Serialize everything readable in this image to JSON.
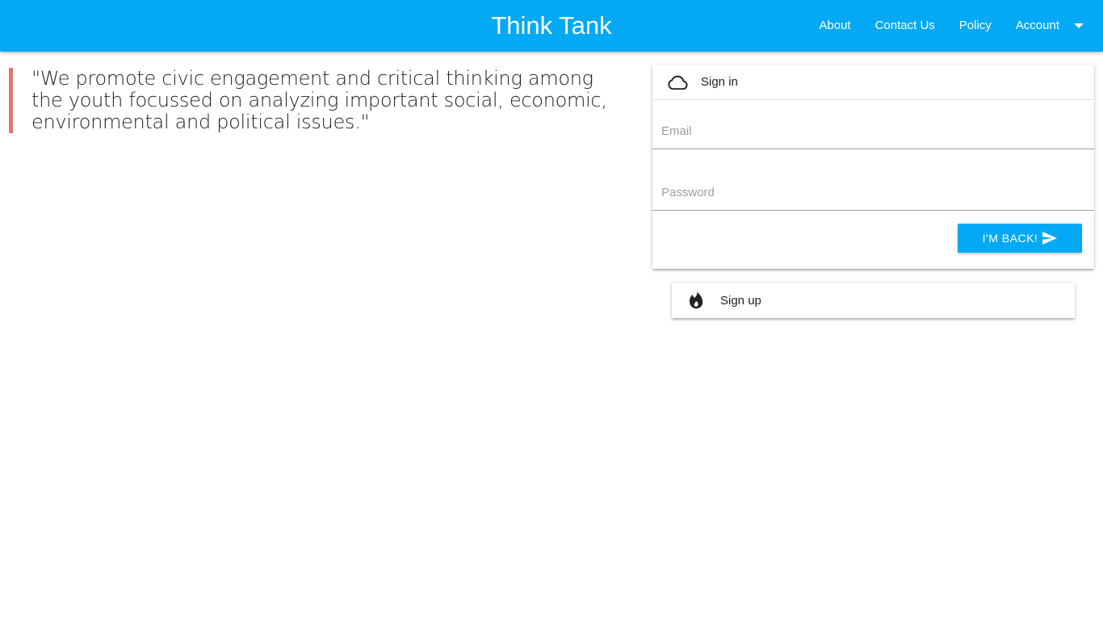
{
  "navbar": {
    "brand": "Think Tank",
    "links": [
      "About",
      "Contact Us",
      "Policy"
    ],
    "account_label": "Account",
    "background": "#03a9f4"
  },
  "quote": {
    "text": "\"We promote civic engagement and critical thinking among the youth focussed on analyzing important social, economic, environmental and political issues.\"",
    "border_color": "#e57373"
  },
  "signin": {
    "header_label": "Sign in",
    "header_icon": "cloud-icon",
    "email_placeholder": "Email",
    "password_placeholder": "Password",
    "submit_label": "I'M BACK!",
    "submit_icon": "send-icon"
  },
  "signup": {
    "header_label": "Sign up",
    "header_icon": "fire-icon"
  }
}
